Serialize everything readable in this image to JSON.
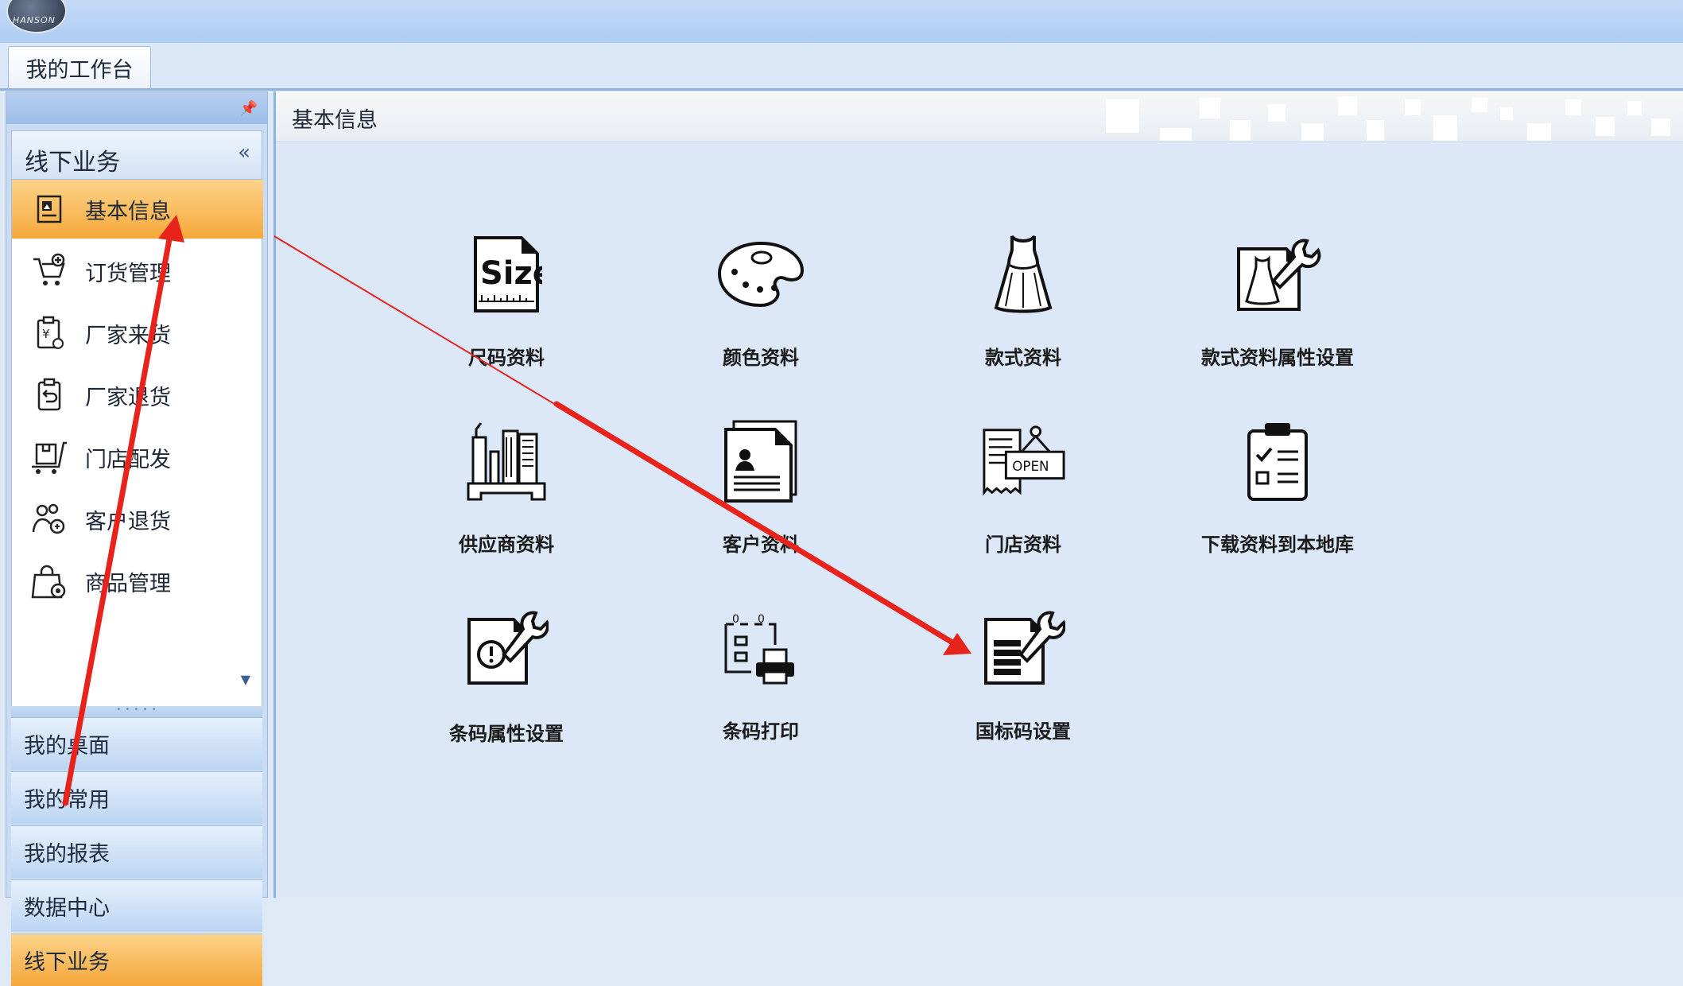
{
  "app": {
    "logo_text": "HANSON"
  },
  "workspace_tab": {
    "label": "我的工作台"
  },
  "sidebar": {
    "group_title": "线下业务",
    "collapse_glyph": "«",
    "items": [
      {
        "label": "基本信息",
        "icon": "info-card-icon",
        "selected": true
      },
      {
        "label": "订货管理",
        "icon": "cart-add-icon"
      },
      {
        "label": "厂家来货",
        "icon": "clipboard-yen-icon"
      },
      {
        "label": "厂家退货",
        "icon": "clipboard-return-icon"
      },
      {
        "label": "门店配发",
        "icon": "cart-box-icon"
      },
      {
        "label": "客户退货",
        "icon": "customer-return-icon"
      },
      {
        "label": "商品管理",
        "icon": "bag-gear-icon"
      }
    ],
    "nav_buttons": [
      {
        "label": "我的桌面"
      },
      {
        "label": "我的常用"
      },
      {
        "label": "我的报表"
      },
      {
        "label": "数据中心"
      },
      {
        "label": "线下业务",
        "active": true
      }
    ]
  },
  "content": {
    "title": "基本信息",
    "tiles": [
      {
        "label": "尺码资料",
        "icon": "size-doc-icon"
      },
      {
        "label": "颜色资料",
        "icon": "palette-icon"
      },
      {
        "label": "款式资料",
        "icon": "dress-icon"
      },
      {
        "label": "款式资料属性设置",
        "icon": "dress-wrench-icon"
      },
      {
        "label": "供应商资料",
        "icon": "factory-icon"
      },
      {
        "label": "客户资料",
        "icon": "customer-doc-icon"
      },
      {
        "label": "门店资料",
        "icon": "store-open-icon"
      },
      {
        "label": "下载资料到本地库",
        "icon": "checklist-icon"
      },
      {
        "label": "条码属性设置",
        "icon": "alert-wrench-icon"
      },
      {
        "label": "条码打印",
        "icon": "barcode-print-icon"
      },
      {
        "label": "国标码设置",
        "icon": "doc-wrench-icon"
      }
    ],
    "open_sign_text": "OPEN",
    "size_text": "Size"
  },
  "colors": {
    "selected": "#f6a93a",
    "annotation": "#e8231c"
  }
}
